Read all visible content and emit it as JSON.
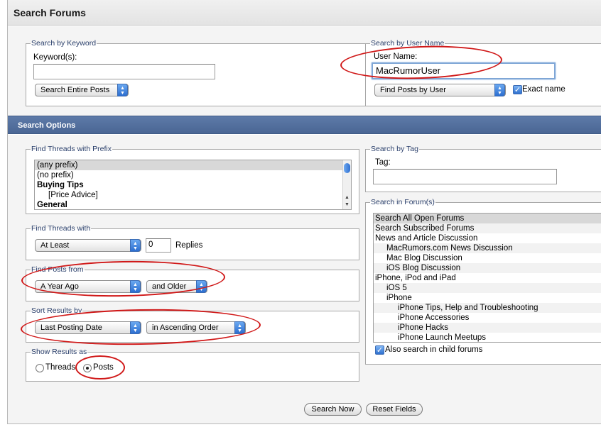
{
  "window": {
    "title": "Search Forums"
  },
  "keyword": {
    "legend": "Search by Keyword",
    "label": "Keyword(s):",
    "value": "",
    "scope": "Search Entire Posts"
  },
  "username": {
    "legend": "Search by User Name",
    "label": "User Name:",
    "value": "MacRumorUser",
    "mode": "Find Posts by User",
    "exact_label": "Exact name",
    "exact_checked": true
  },
  "options": {
    "header": "Search Options",
    "prefix": {
      "legend": "Find Threads with Prefix",
      "items": [
        {
          "text": "(any prefix)",
          "selected": true,
          "bold": false,
          "indent": 0
        },
        {
          "text": "(no prefix)",
          "selected": false,
          "bold": false,
          "indent": 0
        },
        {
          "text": "Buying Tips",
          "selected": false,
          "bold": true,
          "indent": 0
        },
        {
          "text": "[Price Advice]",
          "selected": false,
          "bold": false,
          "indent": 1
        },
        {
          "text": "General",
          "selected": false,
          "bold": true,
          "indent": 0
        }
      ]
    },
    "threads_with": {
      "legend": "Find Threads with",
      "qualifier": "At Least",
      "count": "0",
      "unit": "Replies"
    },
    "posts_from": {
      "legend": "Find Posts from",
      "period": "A Year Ago",
      "direction": "and Older"
    },
    "sort": {
      "legend": "Sort Results by",
      "field": "Last Posting Date",
      "order": "in Ascending Order"
    },
    "show_as": {
      "legend": "Show Results as",
      "threads": "Threads",
      "posts": "Posts",
      "selected": "Posts"
    },
    "tag": {
      "legend": "Search by Tag",
      "label": "Tag:",
      "value": ""
    },
    "forums": {
      "legend": "Search in Forum(s)",
      "items": [
        {
          "text": "Search All Open Forums",
          "indent": 0,
          "selected": true
        },
        {
          "text": "Search Subscribed Forums",
          "indent": 0,
          "selected": false
        },
        {
          "text": "News and Article Discussion",
          "indent": 0,
          "selected": false
        },
        {
          "text": "MacRumors.com News Discussion",
          "indent": 1,
          "selected": false
        },
        {
          "text": "Mac Blog Discussion",
          "indent": 1,
          "selected": false
        },
        {
          "text": "iOS Blog Discussion",
          "indent": 1,
          "selected": false
        },
        {
          "text": "iPhone, iPod and iPad",
          "indent": 0,
          "selected": false
        },
        {
          "text": "iOS 5",
          "indent": 1,
          "selected": false
        },
        {
          "text": "iPhone",
          "indent": 1,
          "selected": false
        },
        {
          "text": "iPhone Tips, Help and Troubleshooting",
          "indent": 2,
          "selected": false
        },
        {
          "text": "iPhone Accessories",
          "indent": 2,
          "selected": false
        },
        {
          "text": "iPhone Hacks",
          "indent": 2,
          "selected": false
        },
        {
          "text": "iPhone Launch Meetups",
          "indent": 2,
          "selected": false
        }
      ],
      "child_label": "Also search in child forums",
      "child_checked": true
    }
  },
  "actions": {
    "search": "Search Now",
    "reset": "Reset Fields"
  },
  "colors": {
    "header_blue": "#4a6694",
    "annotation_red": "#d01818",
    "legend_text": "#2a3f6b"
  }
}
